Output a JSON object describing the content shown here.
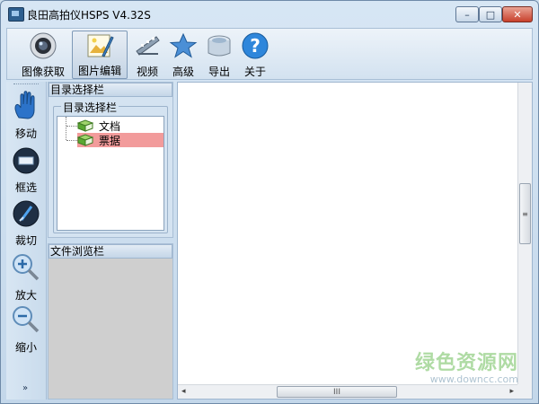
{
  "window": {
    "title": "良田高拍仪HSPS V4.32S",
    "controls": {
      "minimize": "–",
      "maximize": "□",
      "close": "✕"
    }
  },
  "toolbar": {
    "items": [
      {
        "label": "图像获取",
        "icon": "camera-icon"
      },
      {
        "label": "图片编辑",
        "icon": "picture-edit-icon",
        "active": true
      },
      {
        "label": "视频",
        "icon": "film-icon"
      },
      {
        "label": "高级",
        "icon": "star-icon"
      },
      {
        "label": "导出",
        "icon": "export-box-icon"
      },
      {
        "label": "关于",
        "icon": "help-icon"
      }
    ]
  },
  "left_tools": {
    "items": [
      {
        "label": "移动",
        "icon": "hand-icon"
      },
      {
        "label": "框选",
        "icon": "box-select-icon"
      },
      {
        "label": "裁切",
        "icon": "crop-icon"
      },
      {
        "label": "放大",
        "icon": "zoom-in-icon"
      },
      {
        "label": "缩小",
        "icon": "zoom-out-icon"
      }
    ],
    "more": "»"
  },
  "directory_panel": {
    "title": "目录选择栏",
    "group_label": "目录选择栏",
    "nodes": [
      {
        "label": "文档",
        "selected": false
      },
      {
        "label": "票据",
        "selected": true
      }
    ],
    "selected_color": "#f29b9b"
  },
  "browser_panel": {
    "title": "文件浏览栏"
  },
  "viewer": {
    "vscroll_grip": "≡",
    "hscroll_left": "◂",
    "hscroll_right": "▸",
    "hscroll_grip": "III"
  },
  "watermark": {
    "main": "绿色资源网",
    "sub": "www.downcc.com"
  }
}
